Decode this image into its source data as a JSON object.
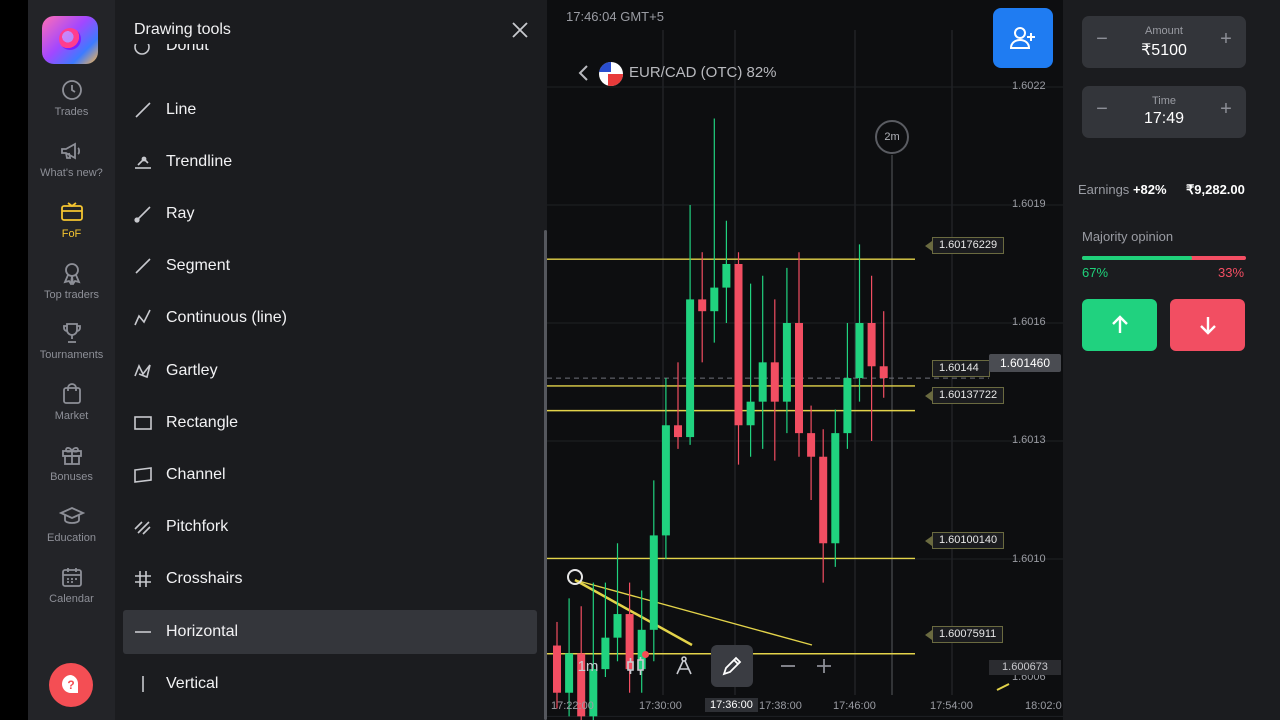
{
  "rail": {
    "items": [
      {
        "label": "Trades",
        "icon": "clock-icon"
      },
      {
        "label": "What's new?",
        "icon": "megaphone-icon"
      },
      {
        "label": "FoF",
        "icon": "fof-icon",
        "active": true
      },
      {
        "label": "Top traders",
        "icon": "medal-icon"
      },
      {
        "label": "Tournaments",
        "icon": "trophy-icon"
      },
      {
        "label": "Market",
        "icon": "shopping-bag-icon"
      },
      {
        "label": "Bonuses",
        "icon": "gift-icon"
      },
      {
        "label": "Education",
        "icon": "graduation-cap-icon"
      },
      {
        "label": "Calendar",
        "icon": "calendar-icon"
      }
    ],
    "help_icon": "question-icon"
  },
  "panel": {
    "title": "Drawing tools",
    "cut_off_item": "Donut",
    "items": [
      {
        "label": "Line",
        "icon": "line-icon"
      },
      {
        "label": "Trendline",
        "icon": "trendline-icon"
      },
      {
        "label": "Ray",
        "icon": "ray-icon"
      },
      {
        "label": "Segment",
        "icon": "segment-icon"
      },
      {
        "label": "Continuous (line)",
        "icon": "continuous-line-icon"
      },
      {
        "label": "Gartley",
        "icon": "gartley-icon"
      },
      {
        "label": "Rectangle",
        "icon": "rectangle-icon"
      },
      {
        "label": "Channel",
        "icon": "channel-icon"
      },
      {
        "label": "Pitchfork",
        "icon": "pitchfork-icon"
      },
      {
        "label": "Crosshairs",
        "icon": "crosshairs-icon"
      },
      {
        "label": "Horizontal",
        "icon": "horizontal-line-icon",
        "active": true
      },
      {
        "label": "Vertical",
        "icon": "vertical-line-icon"
      }
    ]
  },
  "chart": {
    "clock": "17:46:04 GMT+5",
    "pair": "EUR/CAD (OTC) 82%",
    "timer": "2m",
    "current_price": "1.601460",
    "low_price": "1.600673",
    "yaxis": [
      "1.6022",
      "1.6019",
      "1.6016",
      "1.6013",
      "1.6010",
      "1.6006"
    ],
    "xaxis": [
      "17:22:00",
      "17:30:00",
      "17:36:00",
      "17:38:00",
      "17:46:00",
      "17:54:00",
      "18:02:0"
    ],
    "levels": [
      "1.60176229",
      "1.60144",
      "1.60137722",
      "1.60100140",
      "1.60075911"
    ],
    "toolbar": {
      "timeframe": "1m"
    }
  },
  "chart_data": {
    "type": "candlestick",
    "title": "",
    "yaxis_ticks": [
      1.6022,
      1.6019,
      1.6016,
      1.6013,
      1.601,
      1.6006
    ],
    "ylim": [
      1.6005,
      1.6024
    ],
    "horizontal_levels": [
      1.60176229,
      1.60144,
      1.60137722,
      1.6010014,
      1.60075911
    ],
    "current_price": 1.60146,
    "candles": [
      {
        "o": 1.60078,
        "c": 1.60066,
        "h": 1.60084,
        "l": 1.60062
      },
      {
        "o": 1.60066,
        "c": 1.60076,
        "h": 1.6009,
        "l": 1.6006
      },
      {
        "o": 1.60076,
        "c": 1.6006,
        "h": 1.60088,
        "l": 1.60054
      },
      {
        "o": 1.6006,
        "c": 1.60072,
        "h": 1.60094,
        "l": 1.60058
      },
      {
        "o": 1.60072,
        "c": 1.6008,
        "h": 1.60094,
        "l": 1.6007
      },
      {
        "o": 1.6008,
        "c": 1.60086,
        "h": 1.60104,
        "l": 1.60074
      },
      {
        "o": 1.60086,
        "c": 1.60072,
        "h": 1.60094,
        "l": 1.60066
      },
      {
        "o": 1.60072,
        "c": 1.60082,
        "h": 1.60092,
        "l": 1.60066
      },
      {
        "o": 1.60082,
        "c": 1.60106,
        "h": 1.6012,
        "l": 1.60074
      },
      {
        "o": 1.60106,
        "c": 1.60134,
        "h": 1.60146,
        "l": 1.601
      },
      {
        "o": 1.60134,
        "c": 1.60131,
        "h": 1.6015,
        "l": 1.60128
      },
      {
        "o": 1.60131,
        "c": 1.60166,
        "h": 1.6019,
        "l": 1.60129
      },
      {
        "o": 1.60166,
        "c": 1.60163,
        "h": 1.60178,
        "l": 1.6015
      },
      {
        "o": 1.60163,
        "c": 1.60169,
        "h": 1.60212,
        "l": 1.60155
      },
      {
        "o": 1.60169,
        "c": 1.60175,
        "h": 1.60186,
        "l": 1.6016
      },
      {
        "o": 1.60175,
        "c": 1.60134,
        "h": 1.60178,
        "l": 1.60124
      },
      {
        "o": 1.60134,
        "c": 1.6014,
        "h": 1.6017,
        "l": 1.60126
      },
      {
        "o": 1.6014,
        "c": 1.6015,
        "h": 1.60172,
        "l": 1.60128
      },
      {
        "o": 1.6015,
        "c": 1.6014,
        "h": 1.60166,
        "l": 1.60125
      },
      {
        "o": 1.6014,
        "c": 1.6016,
        "h": 1.60174,
        "l": 1.60132
      },
      {
        "o": 1.6016,
        "c": 1.60132,
        "h": 1.60178,
        "l": 1.60126
      },
      {
        "o": 1.60132,
        "c": 1.60126,
        "h": 1.60139,
        "l": 1.60115
      },
      {
        "o": 1.60126,
        "c": 1.60104,
        "h": 1.60133,
        "l": 1.60094
      },
      {
        "o": 1.60104,
        "c": 1.60132,
        "h": 1.60138,
        "l": 1.60098
      },
      {
        "o": 1.60132,
        "c": 1.60146,
        "h": 1.6016,
        "l": 1.60128
      },
      {
        "o": 1.60146,
        "c": 1.6016,
        "h": 1.6018,
        "l": 1.6014
      },
      {
        "o": 1.6016,
        "c": 1.60149,
        "h": 1.60172,
        "l": 1.6013
      },
      {
        "o": 1.60149,
        "c": 1.60146,
        "h": 1.60163,
        "l": 1.60141
      }
    ]
  },
  "trade": {
    "amount_label": "Amount",
    "amount_value": "₹5100",
    "time_label": "Time",
    "time_value": "17:49",
    "earnings_label": "Earnings",
    "earnings_pct": "+82%",
    "earnings_amount": "₹9,282.00",
    "majority_label": "Majority opinion",
    "majority_up_pct": "67%",
    "majority_down_pct": "33%",
    "majority_up_fraction": 0.67,
    "minus": "−",
    "plus": "+",
    "colors": {
      "up": "#20d27f",
      "down": "#f24e62",
      "accent": "#1f7cf2"
    }
  }
}
